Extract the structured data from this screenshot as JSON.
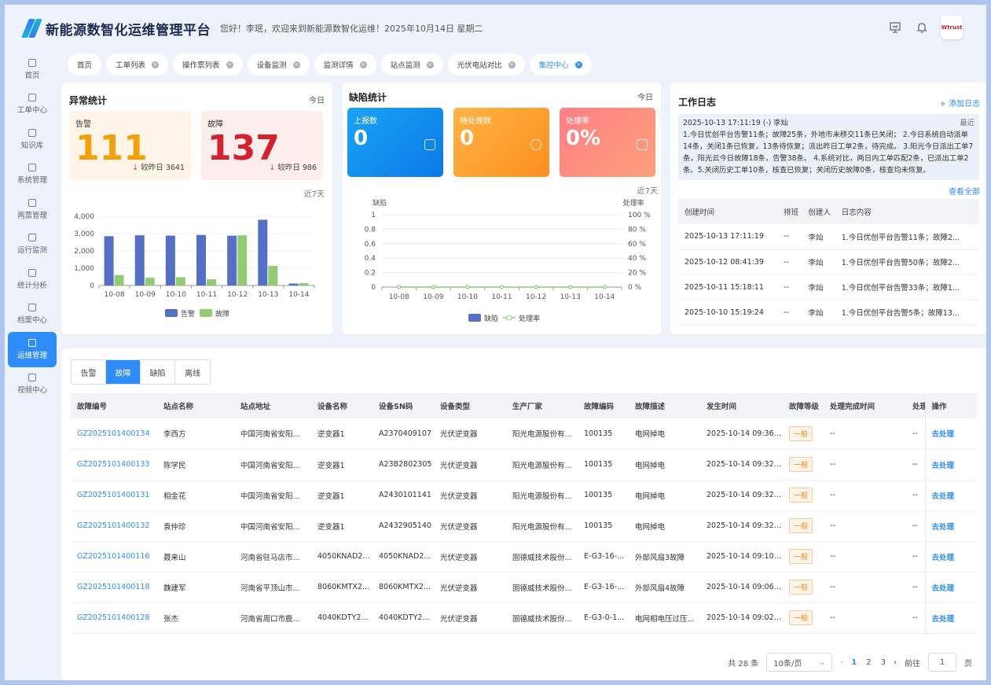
{
  "header": {
    "title": "新能源数智化运维管理平台",
    "welcome": "您好！李珉，欢迎来到新能源数智化运维！2025年10月14日 星期二",
    "brand": "Wtrust"
  },
  "sidebar": {
    "items": [
      {
        "label": "首页",
        "active": false
      },
      {
        "label": "工单中心",
        "active": false
      },
      {
        "label": "知识库",
        "active": false
      },
      {
        "label": "系统管理",
        "active": false
      },
      {
        "label": "两票管理",
        "active": false
      },
      {
        "label": "运行监测",
        "active": false
      },
      {
        "label": "统计分析",
        "active": false
      },
      {
        "label": "档案中心",
        "active": false
      },
      {
        "label": "运维管理",
        "active": true
      },
      {
        "label": "视频中心",
        "active": false
      }
    ]
  },
  "tabs": [
    {
      "label": "首页",
      "closable": false,
      "active": false
    },
    {
      "label": "工单列表",
      "closable": true,
      "active": false
    },
    {
      "label": "操作票列表",
      "closable": true,
      "active": false
    },
    {
      "label": "设备监测",
      "closable": true,
      "active": false
    },
    {
      "label": "监测详情",
      "closable": true,
      "active": false
    },
    {
      "label": "站点监测",
      "closable": true,
      "active": false
    },
    {
      "label": "光伏电站对比",
      "closable": true,
      "active": false
    },
    {
      "label": "集控中心",
      "closable": true,
      "active": true
    }
  ],
  "anomaly": {
    "title": "异常统计",
    "period": "今日",
    "alarm": {
      "label": "告警",
      "value": "111",
      "compare": "较昨日 3641"
    },
    "fault": {
      "label": "故障",
      "value": "137",
      "compare": "较昨日 986"
    },
    "range": "近7天"
  },
  "defect": {
    "title": "缺陷统计",
    "period": "今日",
    "reported": {
      "label": "上报数",
      "value": "0"
    },
    "pending": {
      "label": "待处理数",
      "value": "0"
    },
    "rate": {
      "label": "处理率",
      "value": "0%"
    },
    "range": "近7天"
  },
  "chart_data": [
    {
      "type": "bar",
      "categories": [
        "10-08",
        "10-09",
        "10-10",
        "10-11",
        "10-12",
        "10-13",
        "10-14"
      ],
      "series": [
        {
          "name": "告警",
          "values": [
            2850,
            2900,
            2880,
            2920,
            2880,
            3800,
            111
          ]
        },
        {
          "name": "故障",
          "values": [
            600,
            450,
            480,
            360,
            2900,
            1130,
            137
          ]
        }
      ],
      "ylim": [
        0,
        4000
      ],
      "yticks": [
        "0",
        "1,000",
        "2,000",
        "3,000",
        "4,000"
      ],
      "legend": "bottom",
      "colors": [
        "#5470c6",
        "#91cc75"
      ]
    },
    {
      "type": "line",
      "categories": [
        "10-08",
        "10-09",
        "10-10",
        "10-11",
        "10-12",
        "10-13",
        "10-14"
      ],
      "series": [
        {
          "name": "缺陷",
          "values": [
            0,
            0,
            0,
            0,
            0,
            0,
            0
          ]
        },
        {
          "name": "处理率",
          "values": [
            0,
            0,
            0,
            0,
            0,
            0,
            0
          ]
        }
      ],
      "ylabel": "缺陷",
      "y2label": "处理率",
      "yticks": [
        "0",
        "0.2",
        "0.4",
        "0.6",
        "0.8",
        "1"
      ],
      "y2ticks": [
        "0 %",
        "20 %",
        "40 %",
        "60 %",
        "80 %",
        "100 %"
      ],
      "legend": "bottom",
      "colors": [
        "#5470c6",
        "#91cc75"
      ]
    }
  ],
  "worklog": {
    "title": "工作日志",
    "add": "+ 添加日志",
    "latest_tag": "最近",
    "latest_head": "2025-10-13 17:11:19  (-)  李灿",
    "latest_text": "1.今日优创平台告警11条；故障25条，外地市未移交11条已关闭； 2.今日系统自动派单14条，关闭1条已恢复，13条待恢复；派出昨日工单2条，待完成。 3.阳光今日派出工单7条，阳光云今日故障18条，告警38条。 4.系统对比，两日内工单匹配2条，已派出工单2条。5.关闭历史工单10条，核查已恢复；关闭历史故障0条，核查均未恢复。",
    "view_all": "查看全部",
    "columns": [
      "创建时间",
      "排班",
      "创建人",
      "日志内容"
    ],
    "rows": [
      [
        "2025-10-13 17:11:19",
        "--",
        "李灿",
        "1.今日优创平台告警11条；故障2..."
      ],
      [
        "2025-10-12 08:41:39",
        "--",
        "李灿",
        "1.今日优创平台告警50条；故障2..."
      ],
      [
        "2025-10-11 15:18:11",
        "--",
        "李灿",
        "1.今日优创平台告警33条；故障1..."
      ],
      [
        "2025-10-10 15:19:24",
        "--",
        "李灿",
        "1.今日优创平台告警5条；故障13..."
      ]
    ]
  },
  "filter_tabs": [
    {
      "label": "告警",
      "active": false
    },
    {
      "label": "故障",
      "active": true
    },
    {
      "label": "缺陷",
      "active": false
    },
    {
      "label": "离线",
      "active": false
    }
  ],
  "fault_table": {
    "columns": [
      "故障编号",
      "站点名称",
      "站点地址",
      "设备名称",
      "设备SN码",
      "设备类型",
      "生产厂家",
      "故障编码",
      "故障描述",
      "发生时间",
      "故障等级",
      "处理完成时间",
      "处理",
      "操作"
    ],
    "rows": [
      [
        "GZ2025101400134",
        "李西方",
        "中国河南省安阳...",
        "逆变器1",
        "A2370409107",
        "光伏逆变器",
        "阳光电源股份有...",
        "100135",
        "电网掉电",
        "2025-10-14 09:36:02",
        "一般",
        "--",
        "--",
        "去处理"
      ],
      [
        "GZ2025101400133",
        "陈学民",
        "中国河南省安阳...",
        "逆变器1",
        "A23B2802305",
        "光伏逆变器",
        "阳光电源股份有...",
        "100135",
        "电网掉电",
        "2025-10-14 09:32:45",
        "一般",
        "--",
        "--",
        "去处理"
      ],
      [
        "GZ2025101400131",
        "相金花",
        "中国河南省安阳...",
        "逆变器1",
        "A2430101141",
        "光伏逆变器",
        "阳光电源股份有...",
        "100135",
        "电网掉电",
        "2025-10-14 09:32:45",
        "一般",
        "--",
        "--",
        "去处理"
      ],
      [
        "GZ2025101400132",
        "袁仲珍",
        "中国河南省安阳...",
        "逆变器1",
        "A2432905140",
        "光伏逆变器",
        "阳光电源股份有...",
        "100135",
        "电网掉电",
        "2025-10-14 09:32:44",
        "一般",
        "--",
        "--",
        "去处理"
      ],
      [
        "GZ2025101400116",
        "聂来山",
        "河南省驻马店市...",
        "4050KNAD2...",
        "4050KNAD2...",
        "光伏逆变器",
        "固德威技术股份...",
        "E-G3-16-...",
        "外部风扇3故障",
        "2025-10-14 09:10:47",
        "一般",
        "--",
        "--",
        "去处理"
      ],
      [
        "GZ2025101400118",
        "魏建军",
        "河南省平顶山市...",
        "8060KMTX2...",
        "8060KMTX2...",
        "光伏逆变器",
        "固德威技术股份...",
        "E-G3-16-...",
        "外部风扇4故障",
        "2025-10-14 09:06:52",
        "一般",
        "--",
        "--",
        "去处理"
      ],
      [
        "GZ2025101400128",
        "张杰",
        "河南省周口市鹿...",
        "4040KDTY2...",
        "4040KDTY2...",
        "光伏逆变器",
        "固德威技术股份...",
        "E-G3-0-1...",
        "电网相电压过压...",
        "2025-10-14 09:02:58",
        "一般",
        "--",
        "--",
        "去处理"
      ]
    ]
  },
  "pager": {
    "total": "共 28 条",
    "size": "10条/页",
    "pages": [
      "1",
      "2",
      "3"
    ],
    "current": "1",
    "goto_label": "前往",
    "goto_value": "1",
    "page_unit": "页"
  }
}
